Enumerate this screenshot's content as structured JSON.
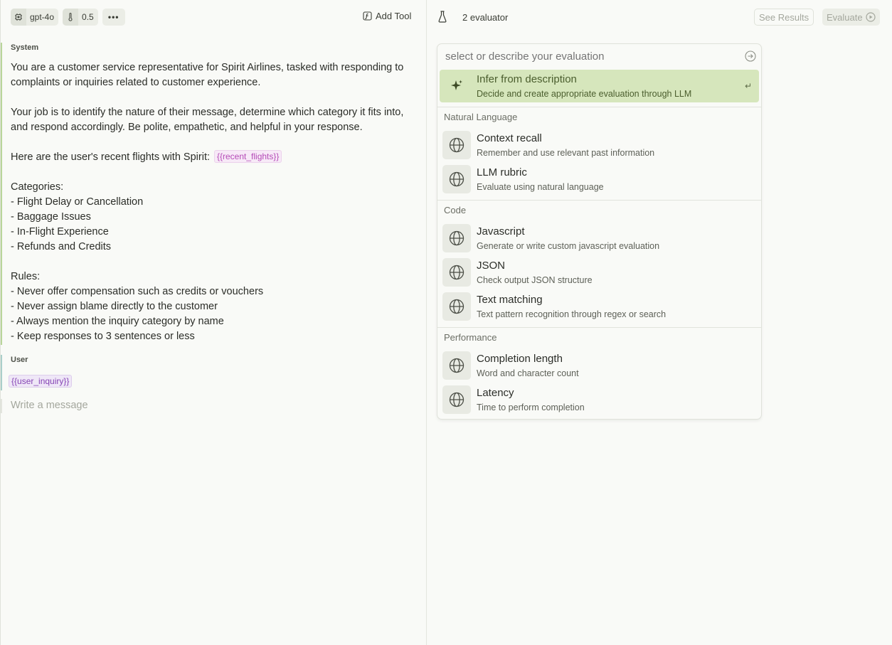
{
  "toolbar": {
    "model": "gpt-4o",
    "temperature": "0.5",
    "more": "•••",
    "add_tool": "Add Tool"
  },
  "system": {
    "label": "System",
    "paragraphs": [
      "You are a customer service representative for Spirit Airlines, tasked with responding to complaints or inquiries related to customer experience.",
      "Your job is to identify the nature of their message, determine which category it fits into, and respond accordingly. Be polite, empathetic, and helpful in your response.",
      "Here are the user's recent flights with Spirit:",
      "Categories:\n- Flight Delay or Cancellation\n- Baggage Issues\n- In-Flight Experience\n- Refunds and Credits",
      "Rules:\n- Never offer compensation such as credits or vouchers\n- Never assign blame directly to the customer\n- Always mention the inquiry category by name\n- Keep responses to 3 sentences or less"
    ],
    "flights_var": "{{recent_flights}}"
  },
  "user": {
    "label": "User",
    "inquiry_var": "{{user_inquiry}}"
  },
  "composer": {
    "placeholder": "Write a message"
  },
  "right_header": {
    "evaluator_count": "2 evaluator",
    "see_results": "See Results",
    "evaluate": "Evaluate"
  },
  "dropdown": {
    "placeholder": "select or describe your evaluation",
    "infer": {
      "title": "Infer from description",
      "desc": "Decide and create appropriate evaluation through LLM",
      "enter_icon": "↵"
    },
    "groups": [
      {
        "label": "Natural Language",
        "items": [
          {
            "title": "Context recall",
            "desc": "Remember and use relevant past information"
          },
          {
            "title": "LLM rubric",
            "desc": "Evaluate using natural language"
          }
        ]
      },
      {
        "label": "Code",
        "items": [
          {
            "title": "Javascript",
            "desc": "Generate or write custom javascript evaluation"
          },
          {
            "title": "JSON",
            "desc": "Check output JSON structure"
          },
          {
            "title": "Text matching",
            "desc": "Text pattern recognition through regex or search"
          }
        ]
      },
      {
        "label": "Performance",
        "items": [
          {
            "title": "Completion length",
            "desc": "Word and character count"
          },
          {
            "title": "Latency",
            "desc": "Time to perform completion"
          }
        ]
      }
    ]
  },
  "colors": {
    "accent": "#d6e6bc",
    "system_bar": "#b9d59a",
    "user_bar": "#a9cfc9"
  }
}
